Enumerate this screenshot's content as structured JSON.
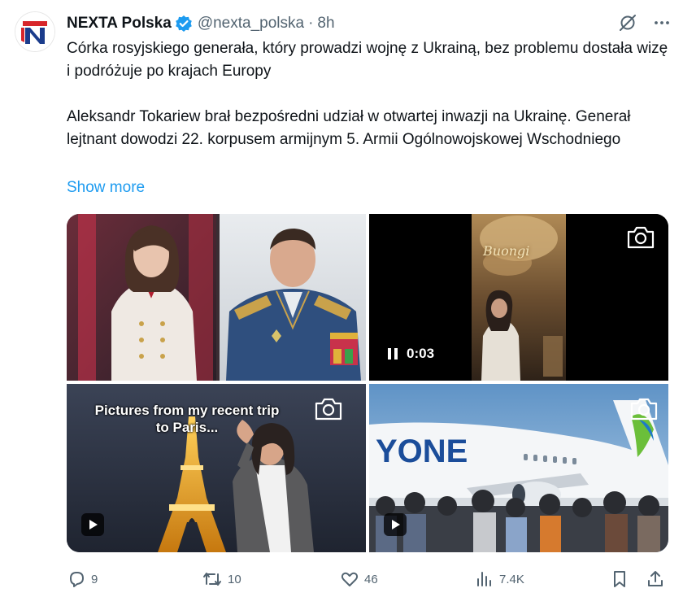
{
  "tweet": {
    "author_name": "NEXTA Polska",
    "handle": "@nexta_polska",
    "separator": "·",
    "time": "8h",
    "paragraph1": "Córka rosyjskiego generała, który prowadzi wojnę z Ukrainą, bez problemu dostała wizę i podróżuje po krajach Europy",
    "paragraph2": "Aleksandr Tokariew brał bezpośredni udział w otwartej inwazji na Ukrainę. Generał lejtnant dowodzi 22. korpusem armijnym 5. Armii Ogólnowojskowej Wschodniego",
    "show_more": "Show more"
  },
  "media": {
    "video_time": "0:03",
    "video_overlay_text": "Buongi",
    "paris_caption_line1": "Pictures from my recent trip",
    "paris_caption_line2": "to Paris..."
  },
  "actions": {
    "replies": "9",
    "reposts": "10",
    "likes": "46",
    "views": "7.4K"
  },
  "icons": [
    "verified-badge-icon",
    "grok-icon",
    "more-icon",
    "camera-icon",
    "pause-icon",
    "play-icon",
    "reply-icon",
    "repost-icon",
    "like-icon",
    "views-icon",
    "bookmark-icon",
    "share-icon"
  ],
  "colors": {
    "accent": "#1d9bf0",
    "secondary_text": "#536471",
    "verified": "#1d9bf0"
  }
}
